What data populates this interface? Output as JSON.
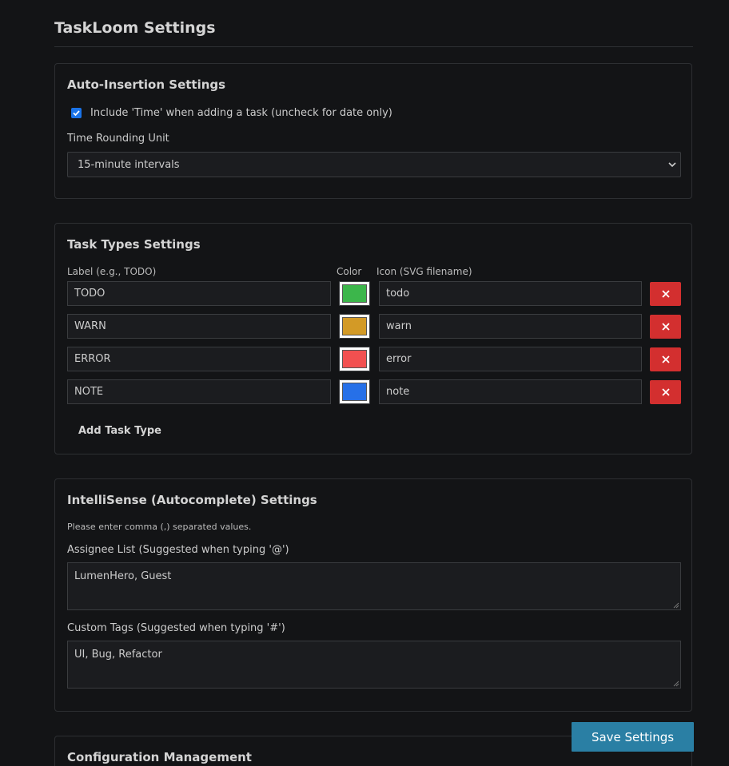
{
  "page": {
    "title": "TaskLoom Settings"
  },
  "auto_insertion": {
    "title": "Auto-Insertion Settings",
    "include_time_checked": true,
    "include_time_label": "Include 'Time' when adding a task (uncheck for date only)",
    "rounding_label": "Time Rounding Unit",
    "rounding_value": "15-minute intervals"
  },
  "task_types": {
    "title": "Task Types Settings",
    "col_label": "Label (e.g., TODO)",
    "col_color": "Color",
    "col_icon": "Icon (SVG filename)",
    "rows": [
      {
        "label": "TODO",
        "color": "#3cb64b",
        "icon": "todo"
      },
      {
        "label": "WARN",
        "color": "#d39a26",
        "icon": "warn"
      },
      {
        "label": "ERROR",
        "color": "#f25050",
        "icon": "error"
      },
      {
        "label": "NOTE",
        "color": "#2670e8",
        "icon": "note"
      }
    ],
    "add_label": "Add Task Type"
  },
  "intellisense": {
    "title": "IntelliSense (Autocomplete) Settings",
    "hint": "Please enter comma (,) separated values.",
    "assignee_label": "Assignee List (Suggested when typing '@')",
    "assignee_value": "LumenHero, Guest",
    "tags_label": "Custom Tags (Suggested when typing '#')",
    "tags_value": "UI, Bug, Refactor"
  },
  "config": {
    "title": "Configuration Management"
  },
  "actions": {
    "save_label": "Save Settings"
  },
  "colors": {
    "background": "#131416",
    "delete_button": "#d32f2f",
    "save_button": "#2a7fa4",
    "checkbox_accent": "#1a73e8"
  }
}
